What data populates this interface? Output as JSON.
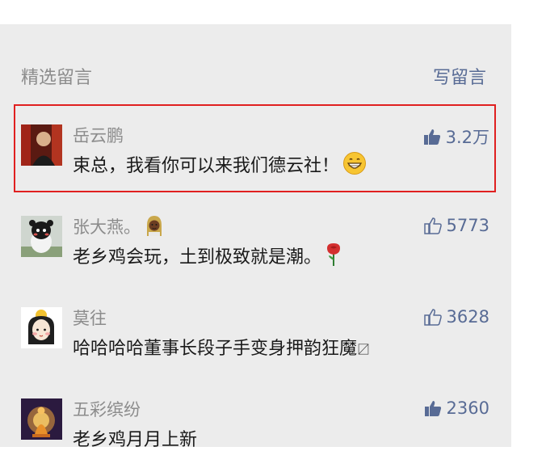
{
  "section": {
    "title": "精选留言",
    "write_label": "写留言"
  },
  "comments": [
    {
      "nickname": "岳云鹏",
      "text": "束总，我看你可以来我们德云社！",
      "likes": "3.2万",
      "liked": true,
      "highlighted": true,
      "emoji": "grinning-face-emoji"
    },
    {
      "nickname": "张大燕。",
      "text": "老乡鸡会玩，土到极致就是潮。",
      "likes": "5773",
      "liked": false,
      "highlighted": false,
      "nick_emoji": "woman-with-headscarf-emoji",
      "emoji": "rose-emoji"
    },
    {
      "nickname": "莫往",
      "text": "哈哈哈哈董事长段子手变身押韵狂魔",
      "likes": "3628",
      "liked": false,
      "highlighted": false,
      "trailing_glyph": "〼"
    },
    {
      "nickname": "五彩缤纷",
      "text": "老乡鸡月月上新",
      "likes": "2360",
      "liked": true,
      "highlighted": false
    }
  ],
  "colors": {
    "link": "#586b95",
    "highlight_border": "#e02020",
    "panel_bg": "#ececec"
  }
}
